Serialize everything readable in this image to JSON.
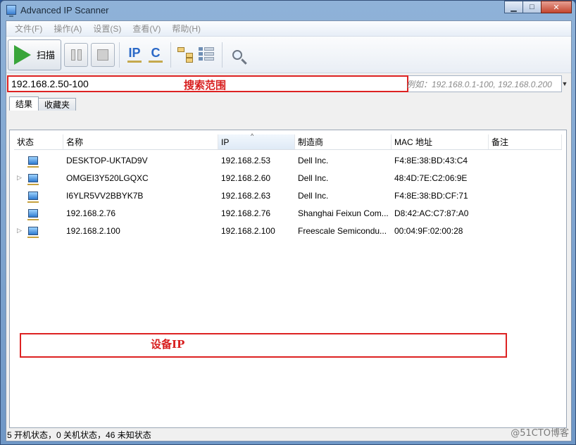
{
  "window": {
    "title": "Advanced IP Scanner"
  },
  "menu": [
    "文件(F)",
    "操作(A)",
    "设置(S)",
    "查看(V)",
    "帮助(H)"
  ],
  "toolbar": {
    "scan_label": "扫描",
    "ip_label": "IP",
    "c_label": "C"
  },
  "range": {
    "value": "192.168.2.50-100",
    "annotation": "搜索范围",
    "hint": "例如：192.168.0.1-100, 192.168.0.200"
  },
  "tabs": [
    "结果",
    "收藏夹"
  ],
  "columns": [
    "状态",
    "名称",
    "IP",
    "制造商",
    "MAC 地址",
    "备注"
  ],
  "rows": [
    {
      "expander": "",
      "name": "DESKTOP-UKTAD9V",
      "ip": "192.168.2.53",
      "vendor": "Dell Inc.",
      "mac": "F4:8E:38:BD:43:C4"
    },
    {
      "expander": "▷",
      "name": "OMGEI3Y520LGQXC",
      "ip": "192.168.2.60",
      "vendor": "Dell Inc.",
      "mac": "48:4D:7E:C2:06:9E"
    },
    {
      "expander": "",
      "name": "I6YLR5VV2BBYK7B",
      "ip": "192.168.2.63",
      "vendor": "Dell Inc.",
      "mac": "F4:8E:38:BD:CF:71"
    },
    {
      "expander": "",
      "name": "192.168.2.76",
      "ip": "192.168.2.76",
      "vendor": "Shanghai Feixun Com...",
      "mac": "D8:42:AC:C7:87:A0"
    },
    {
      "expander": "▷",
      "name": "192.168.2.100",
      "ip": "192.168.2.100",
      "vendor": "Freescale Semicondu...",
      "mac": "00:04:9F:02:00:28"
    }
  ],
  "device_annotation": "设备IP",
  "status": "5 开机状态，0 关机状态，46 未知状态",
  "watermark": "@51CTO博客"
}
